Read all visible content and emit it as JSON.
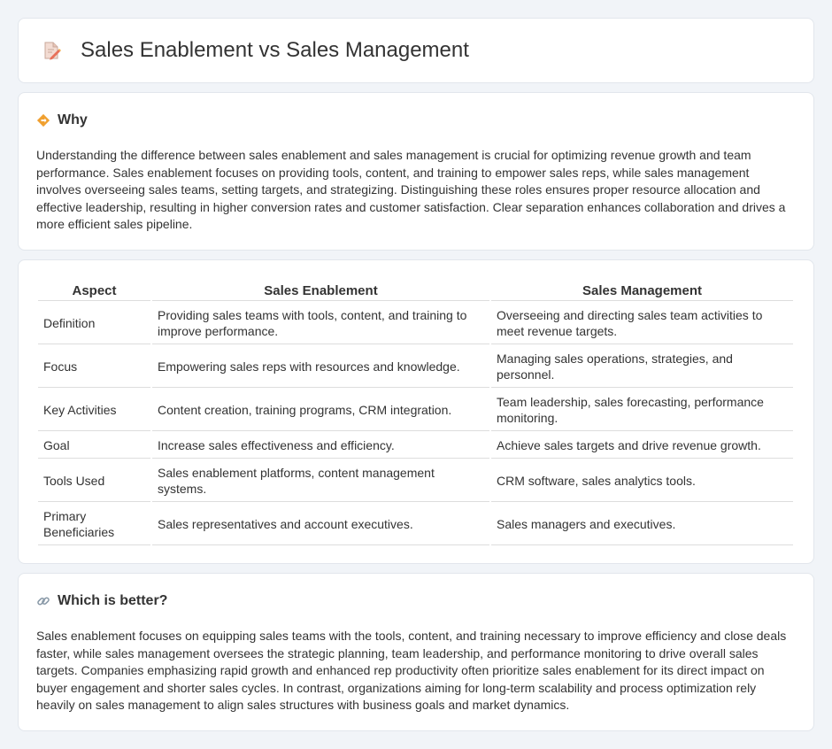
{
  "header": {
    "title": "Sales Enablement vs Sales Management"
  },
  "why": {
    "heading": "Why",
    "text": "Understanding the difference between sales enablement and sales management is crucial for optimizing revenue growth and team performance. Sales enablement focuses on providing tools, content, and training to empower sales reps, while sales management involves overseeing sales teams, setting targets, and strategizing. Distinguishing these roles ensures proper resource allocation and effective leadership, resulting in higher conversion rates and customer satisfaction. Clear separation enhances collaboration and drives a more efficient sales pipeline."
  },
  "table": {
    "headers": [
      "Aspect",
      "Sales Enablement",
      "Sales Management"
    ],
    "rows": [
      [
        "Definition",
        "Providing sales teams with tools, content, and training to improve performance.",
        "Overseeing and directing sales team activities to meet revenue targets."
      ],
      [
        "Focus",
        "Empowering sales reps with resources and knowledge.",
        "Managing sales operations, strategies, and personnel."
      ],
      [
        "Key Activities",
        "Content creation, training programs, CRM integration.",
        "Team leadership, sales forecasting, performance monitoring."
      ],
      [
        "Goal",
        "Increase sales effectiveness and efficiency.",
        "Achieve sales targets and drive revenue growth."
      ],
      [
        "Tools Used",
        "Sales enablement platforms, content management systems.",
        "CRM software, sales analytics tools."
      ],
      [
        "Primary Beneficiaries",
        "Sales representatives and account executives.",
        "Sales managers and executives."
      ]
    ]
  },
  "better": {
    "heading": "Which is better?",
    "text": "Sales enablement focuses on equipping sales teams with the tools, content, and training necessary to improve efficiency and close deals faster, while sales management oversees the strategic planning, team leadership, and performance monitoring to drive overall sales targets. Companies emphasizing rapid growth and enhanced rep productivity often prioritize sales enablement for its direct impact on buyer engagement and shorter sales cycles. In contrast, organizations aiming for long-term scalability and process optimization rely heavily on sales management to align sales structures with business goals and market dynamics."
  }
}
